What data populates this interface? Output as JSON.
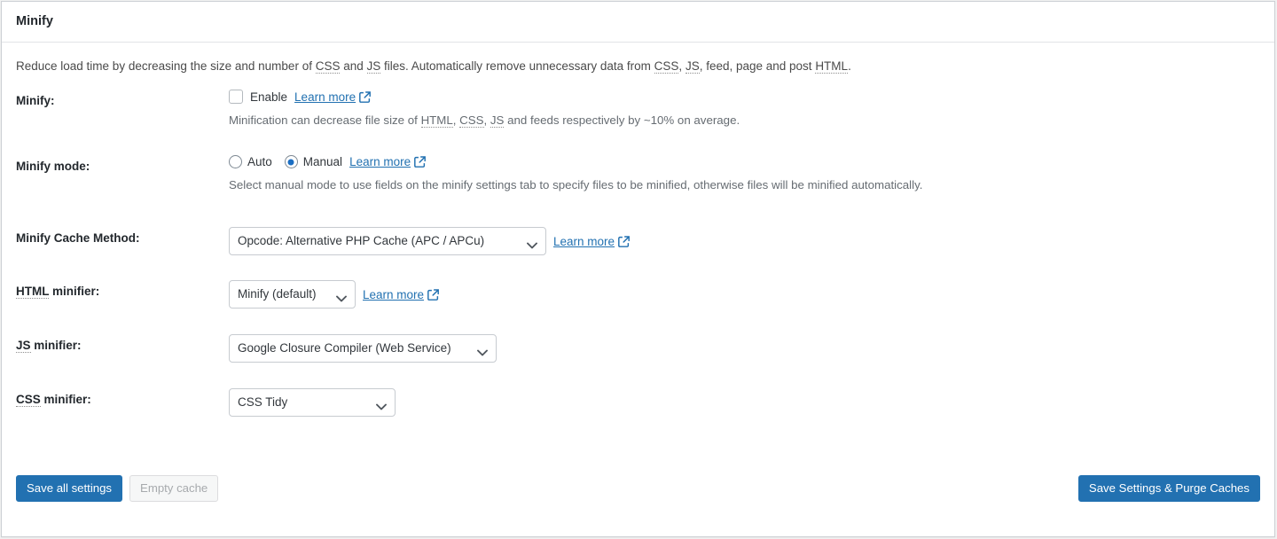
{
  "card": {
    "title": "Minify",
    "intro_parts": [
      {
        "t": "text",
        "v": "Reduce load time by decreasing the size and number of "
      },
      {
        "t": "abbr",
        "v": "CSS"
      },
      {
        "t": "text",
        "v": " and "
      },
      {
        "t": "abbr",
        "v": "JS"
      },
      {
        "t": "text",
        "v": " files. Automatically remove unnecessary data from "
      },
      {
        "t": "abbr",
        "v": "CSS"
      },
      {
        "t": "text",
        "v": ", "
      },
      {
        "t": "abbr",
        "v": "JS"
      },
      {
        "t": "text",
        "v": ", feed, page and post "
      },
      {
        "t": "abbr",
        "v": "HTML"
      },
      {
        "t": "text",
        "v": "."
      }
    ],
    "intro_text": "Reduce load time by decreasing the size and number of CSS and JS files. Automatically remove unnecessary data from CSS, JS, feed, page and post HTML."
  },
  "rows": {
    "minify": {
      "label": "Minify:",
      "checkbox_label": "Enable",
      "checkbox_checked": false,
      "learn_more": "Learn more",
      "helper_prefix": "Minification can decrease file size of ",
      "helper_abbr1": "HTML",
      "helper_sep1": ", ",
      "helper_abbr2": "CSS",
      "helper_sep2": ", ",
      "helper_abbr3": "JS",
      "helper_suffix": " and feeds respectively by ~10% on average.",
      "helper_text": "Minification can decrease file size of HTML, CSS, JS and feeds respectively by ~10% on average."
    },
    "mode": {
      "label": "Minify mode:",
      "option_auto": "Auto",
      "option_manual": "Manual",
      "selected": "Manual",
      "learn_more": "Learn more",
      "helper_text": "Select manual mode to use fields on the minify settings tab to specify files to be minified, otherwise files will be minified automatically."
    },
    "cache_method": {
      "label": "Minify Cache Method:",
      "value": "Opcode: Alternative PHP Cache (APC / APCu)",
      "learn_more": "Learn more"
    },
    "html_minifier": {
      "label_abbr": "HTML",
      "label_rest": " minifier:",
      "value": "Minify (default)",
      "learn_more": "Learn more"
    },
    "js_minifier": {
      "label_abbr": "JS",
      "label_rest": " minifier:",
      "value": "Google Closure Compiler (Web Service)"
    },
    "css_minifier": {
      "label_abbr": "CSS",
      "label_rest": " minifier:",
      "value": "CSS Tidy"
    }
  },
  "footer": {
    "save_all_settings": "Save all settings",
    "empty_cache": "Empty cache",
    "save_and_purge": "Save Settings & Purge Caches"
  },
  "icons": {
    "external_link": "external-link-icon",
    "chevron_down": "chevron-down-icon"
  },
  "colors": {
    "accent": "#2271b1",
    "radio_fill": "#1b6ec2",
    "label_text": "#23282d",
    "helper_text": "#666c72",
    "card_border": "#ccd0d4",
    "page_bg": "#f1f1f1"
  }
}
